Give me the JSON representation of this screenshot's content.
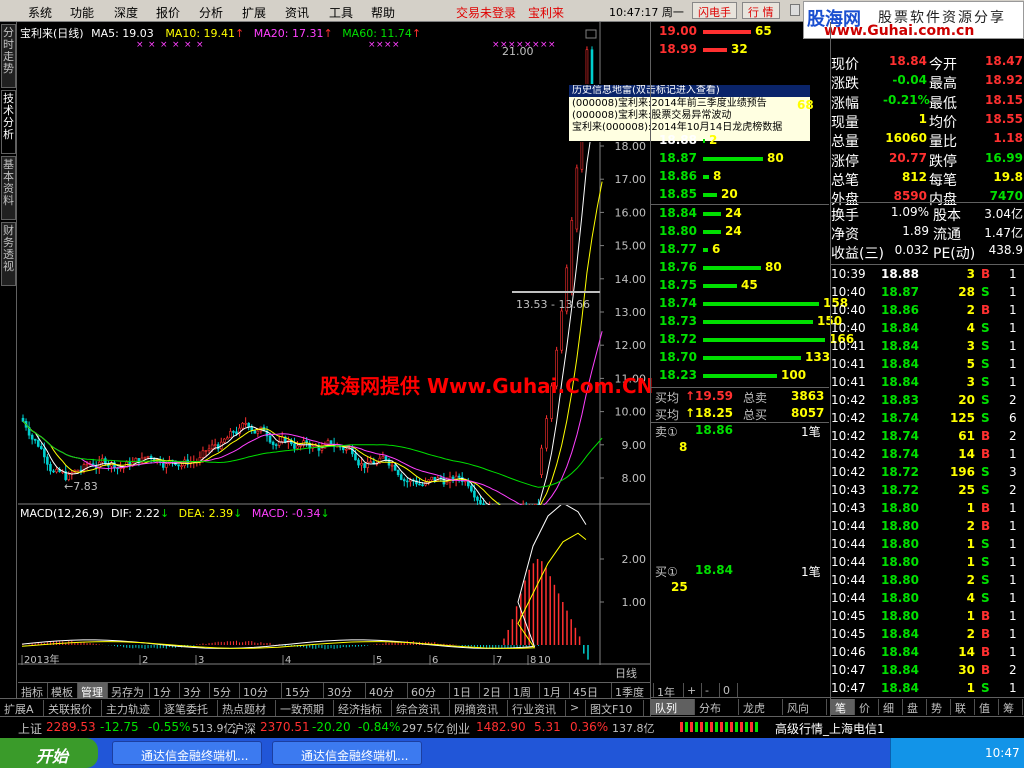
{
  "menu": {
    "items": [
      "系统",
      "功能",
      "深度",
      "报价",
      "分析",
      "扩展",
      "资讯",
      "工具",
      "帮助"
    ],
    "login": "交易未登录",
    "stock": "宝利来",
    "clock": "10:47:17 周一",
    "btn_flash": "闪电手",
    "btn_quote": "行 情"
  },
  "logo": {
    "l1": "股海网",
    "l2": "股票软件资源分享",
    "l3": "www.Guhai.com.cn"
  },
  "lefttabs": [
    "分时走势",
    "技术分析",
    "基本资料",
    "财务透视"
  ],
  "chart": {
    "title": "宝利来(日线)",
    "ma5": "MA5: 19.03",
    "ma10": "MA10: 19.41",
    "ma20": "MA20: 17.31",
    "ma60": "MA60: 11.74",
    "high_label": "21.00",
    "range_label": "13.53 - 13.66",
    "low_label": "←7.83",
    "macd_legend": "MACD(12,26,9)",
    "dif": "DIF: 2.22",
    "dea": "DEA: 2.39",
    "macd": "MACD: -0.34",
    "period": "日线"
  },
  "tooltip": {
    "title": "历史信息地雷(双击标记进入查看)",
    "lines": [
      "(000008)宝利来:2014年前三季度业绩预告",
      "(000008)宝利来:股票交易异常波动",
      "宝利来(000008):2014年10月14日龙虎榜数据"
    ]
  },
  "watermark": "股海网提供 Www.Guhai.Com.CN",
  "chart_data": [
    {
      "type": "candlestick",
      "title": "宝利来(日线)",
      "y_ticks": [
        8.0,
        9.0,
        10.0,
        11.0,
        12.0,
        13.0,
        14.0,
        15.0,
        16.0,
        17.0,
        18.0
      ],
      "x_ticks": [
        "2013年",
        "2",
        "3",
        "4",
        "5",
        "6",
        "7",
        "8",
        "9",
        "10"
      ],
      "annotations": [
        "21.00",
        "13.53 - 13.66",
        "←7.83"
      ]
    },
    {
      "type": "bar",
      "title": "MACD(12,26,9)",
      "y_ticks": [
        1.0,
        2.0
      ],
      "series": [
        {
          "name": "DIF",
          "values": [
            2.22
          ]
        },
        {
          "name": "DEA",
          "values": [
            2.39
          ]
        },
        {
          "name": "MACD",
          "values": [
            -0.34
          ]
        }
      ]
    }
  ],
  "toolbar": [
    "指标",
    "模板",
    "管理",
    "另存为",
    "1分",
    "3分",
    "5分",
    "10分",
    "15分",
    "30分",
    "40分",
    "60分",
    "1日",
    "2日",
    "1周",
    "1月",
    "45日",
    "1季度",
    "1年",
    "+",
    "-",
    "0"
  ],
  "btabs": [
    "扩展A",
    "关联报价",
    "主力轨迹",
    "逐笔委托",
    "热点题材",
    "一致预期",
    "经济指标",
    "综合资讯",
    "网摘资讯",
    "行业资讯",
    ">",
    "图文F10"
  ],
  "asks": [
    {
      "p": "19.00",
      "v": "65",
      "w": 48
    },
    {
      "p": "18.99",
      "v": "32",
      "w": 24
    },
    {
      "p": "18.88",
      "v": "2",
      "w": 2
    },
    {
      "p": "18.87",
      "v": "80",
      "w": 60
    },
    {
      "p": "18.86",
      "v": "8",
      "w": 6
    },
    {
      "p": "18.85",
      "v": "20",
      "w": 14
    }
  ],
  "bids": [
    {
      "p": "18.84",
      "v": "24",
      "w": 18
    },
    {
      "p": "18.80",
      "v": "24",
      "w": 18
    },
    {
      "p": "18.77",
      "v": "6",
      "w": 5
    },
    {
      "p": "18.76",
      "v": "80",
      "w": 58
    },
    {
      "p": "18.75",
      "v": "45",
      "w": 34
    },
    {
      "p": "18.74",
      "v": "158",
      "w": 116
    },
    {
      "p": "18.73",
      "v": "150",
      "w": 110
    },
    {
      "p": "18.72",
      "v": "166",
      "w": 122
    },
    {
      "p": "18.70",
      "v": "133",
      "w": 98
    },
    {
      "p": "18.23",
      "v": "100",
      "w": 74
    }
  ],
  "partial_vol": "68",
  "summary": {
    "buy_avg": "买均",
    "buy_avg_val": "19.59",
    "total_sell": "总卖",
    "total_sell_val": "3863",
    "sell_avg": "买均",
    "sell_avg_val": "18.25",
    "total_buy": "总买",
    "total_buy_val": "8057",
    "sell1": "卖①",
    "sell1_p": "18.86",
    "sell1_v": "1笔",
    "sell1_q": "8",
    "buy1": "买①",
    "buy1_p": "18.84",
    "buy1_v": "1笔",
    "buy1_q": "25"
  },
  "quote": [
    [
      "现价",
      "18.84",
      "今开",
      "18.47"
    ],
    [
      "涨跌",
      "-0.04",
      "最高",
      "18.92"
    ],
    [
      "涨幅",
      "-0.21%",
      "最低",
      "18.15"
    ],
    [
      "现量",
      "1",
      "均价",
      "18.55"
    ],
    [
      "总量",
      "16060",
      "量比",
      "1.18"
    ],
    [
      "涨停",
      "20.77",
      "跌停",
      "16.99"
    ],
    [
      "总笔",
      "812",
      "每笔",
      "19.8"
    ],
    [
      "外盘",
      "8590",
      "内盘",
      "7470"
    ]
  ],
  "fund": [
    [
      "换手",
      "1.09%",
      "股本",
      "3.04亿"
    ],
    [
      "净资",
      "1.89",
      "流通",
      "1.47亿"
    ],
    [
      "收益(三)",
      "0.032",
      "PE(动)",
      "438.9"
    ]
  ],
  "ticks": [
    [
      "10:39",
      "18.88",
      "3",
      "B",
      "1"
    ],
    [
      "10:40",
      "18.87",
      "28",
      "S",
      "1"
    ],
    [
      "10:40",
      "18.86",
      "2",
      "B",
      "1"
    ],
    [
      "10:40",
      "18.84",
      "4",
      "S",
      "1"
    ],
    [
      "10:41",
      "18.84",
      "3",
      "S",
      "1"
    ],
    [
      "10:41",
      "18.84",
      "5",
      "S",
      "1"
    ],
    [
      "10:41",
      "18.84",
      "3",
      "S",
      "1"
    ],
    [
      "10:42",
      "18.83",
      "20",
      "S",
      "2"
    ],
    [
      "10:42",
      "18.74",
      "125",
      "S",
      "6"
    ],
    [
      "10:42",
      "18.74",
      "61",
      "B",
      "2"
    ],
    [
      "10:42",
      "18.74",
      "14",
      "B",
      "1"
    ],
    [
      "10:42",
      "18.72",
      "196",
      "S",
      "3"
    ],
    [
      "10:43",
      "18.72",
      "25",
      "S",
      "2"
    ],
    [
      "10:43",
      "18.80",
      "1",
      "B",
      "1"
    ],
    [
      "10:44",
      "18.80",
      "2",
      "B",
      "1"
    ],
    [
      "10:44",
      "18.80",
      "1",
      "S",
      "1"
    ],
    [
      "10:44",
      "18.80",
      "1",
      "S",
      "1"
    ],
    [
      "10:44",
      "18.80",
      "2",
      "S",
      "1"
    ],
    [
      "10:44",
      "18.80",
      "4",
      "S",
      "1"
    ],
    [
      "10:45",
      "18.80",
      "1",
      "B",
      "1"
    ],
    [
      "10:45",
      "18.84",
      "2",
      "B",
      "1"
    ],
    [
      "10:46",
      "18.84",
      "14",
      "B",
      "1"
    ],
    [
      "10:47",
      "18.84",
      "30",
      "B",
      "2"
    ],
    [
      "10:47",
      "18.84",
      "1",
      "S",
      "1"
    ]
  ],
  "right_tabs": [
    "队列",
    "分布",
    "龙虎",
    "风向"
  ],
  "right_tabs2": [
    "笔",
    "价",
    "细",
    "盘",
    "势",
    "联",
    "值",
    "筹"
  ],
  "status": {
    "sh": "上证",
    "sh_val": "2289.53",
    "sh_chg": "-12.75",
    "sh_pct": "-0.55%",
    "sh_amt": "513.9亿",
    "sz": "沪深",
    "sz_val": "2370.51",
    "sz_chg": "-20.20",
    "sz_pct": "-0.84%",
    "sz_amt": "297.5亿",
    "cy": "创业",
    "cy_val": "1482.90",
    "cy_chg": "5.31",
    "cy_pct": "0.36%",
    "cy_amt": "137.8亿",
    "server": "高级行情_上海电信1"
  },
  "taskbar": {
    "start": "开始",
    "t1": "通达信金融终端机...",
    "t2": "通达信金融终端机...",
    "time": "10:47"
  }
}
